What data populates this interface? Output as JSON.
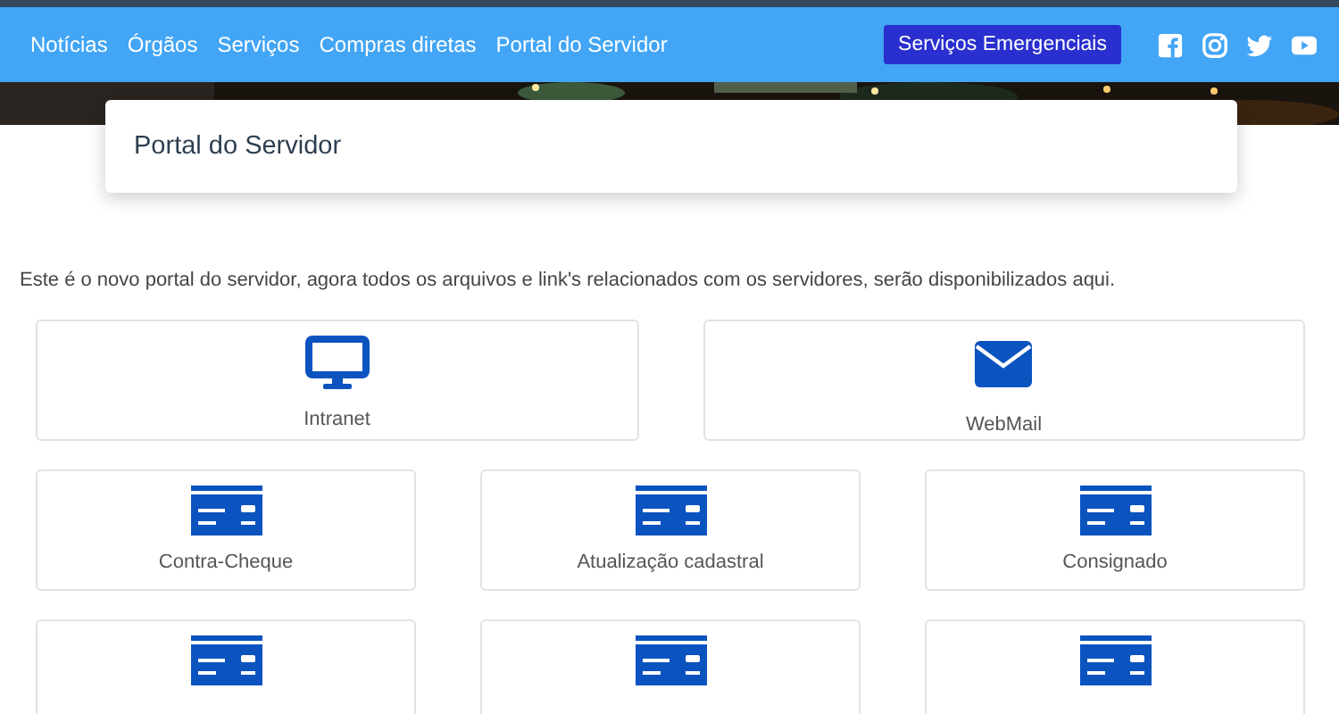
{
  "nav": {
    "links": [
      "Notícias",
      "Órgãos",
      "Serviços",
      "Compras diretas",
      "Portal do Servidor"
    ],
    "emergency_button": "Serviços Emergenciais",
    "social": [
      {
        "kind": "facebook"
      },
      {
        "kind": "instagram"
      },
      {
        "kind": "twitter"
      },
      {
        "kind": "youtube"
      }
    ]
  },
  "page_title": "Portal do Servidor",
  "intro": "Este é o novo portal do servidor, agora todos os arquivos e link's relacionados com os servidores, serão disponibilizados aqui.",
  "tile_rows": [
    {
      "tiles": [
        {
          "kind": "monitor",
          "label": "Intranet"
        },
        {
          "kind": "mail",
          "label": "WebMail"
        }
      ]
    },
    {
      "tiles": [
        {
          "kind": "card",
          "label": "Contra-Cheque"
        },
        {
          "kind": "card",
          "label": "Atualização cadastral"
        },
        {
          "kind": "card",
          "label": "Consignado"
        }
      ]
    },
    {
      "tiles": [
        {
          "kind": "card"
        },
        {
          "kind": "card"
        },
        {
          "kind": "card"
        }
      ]
    }
  ]
}
